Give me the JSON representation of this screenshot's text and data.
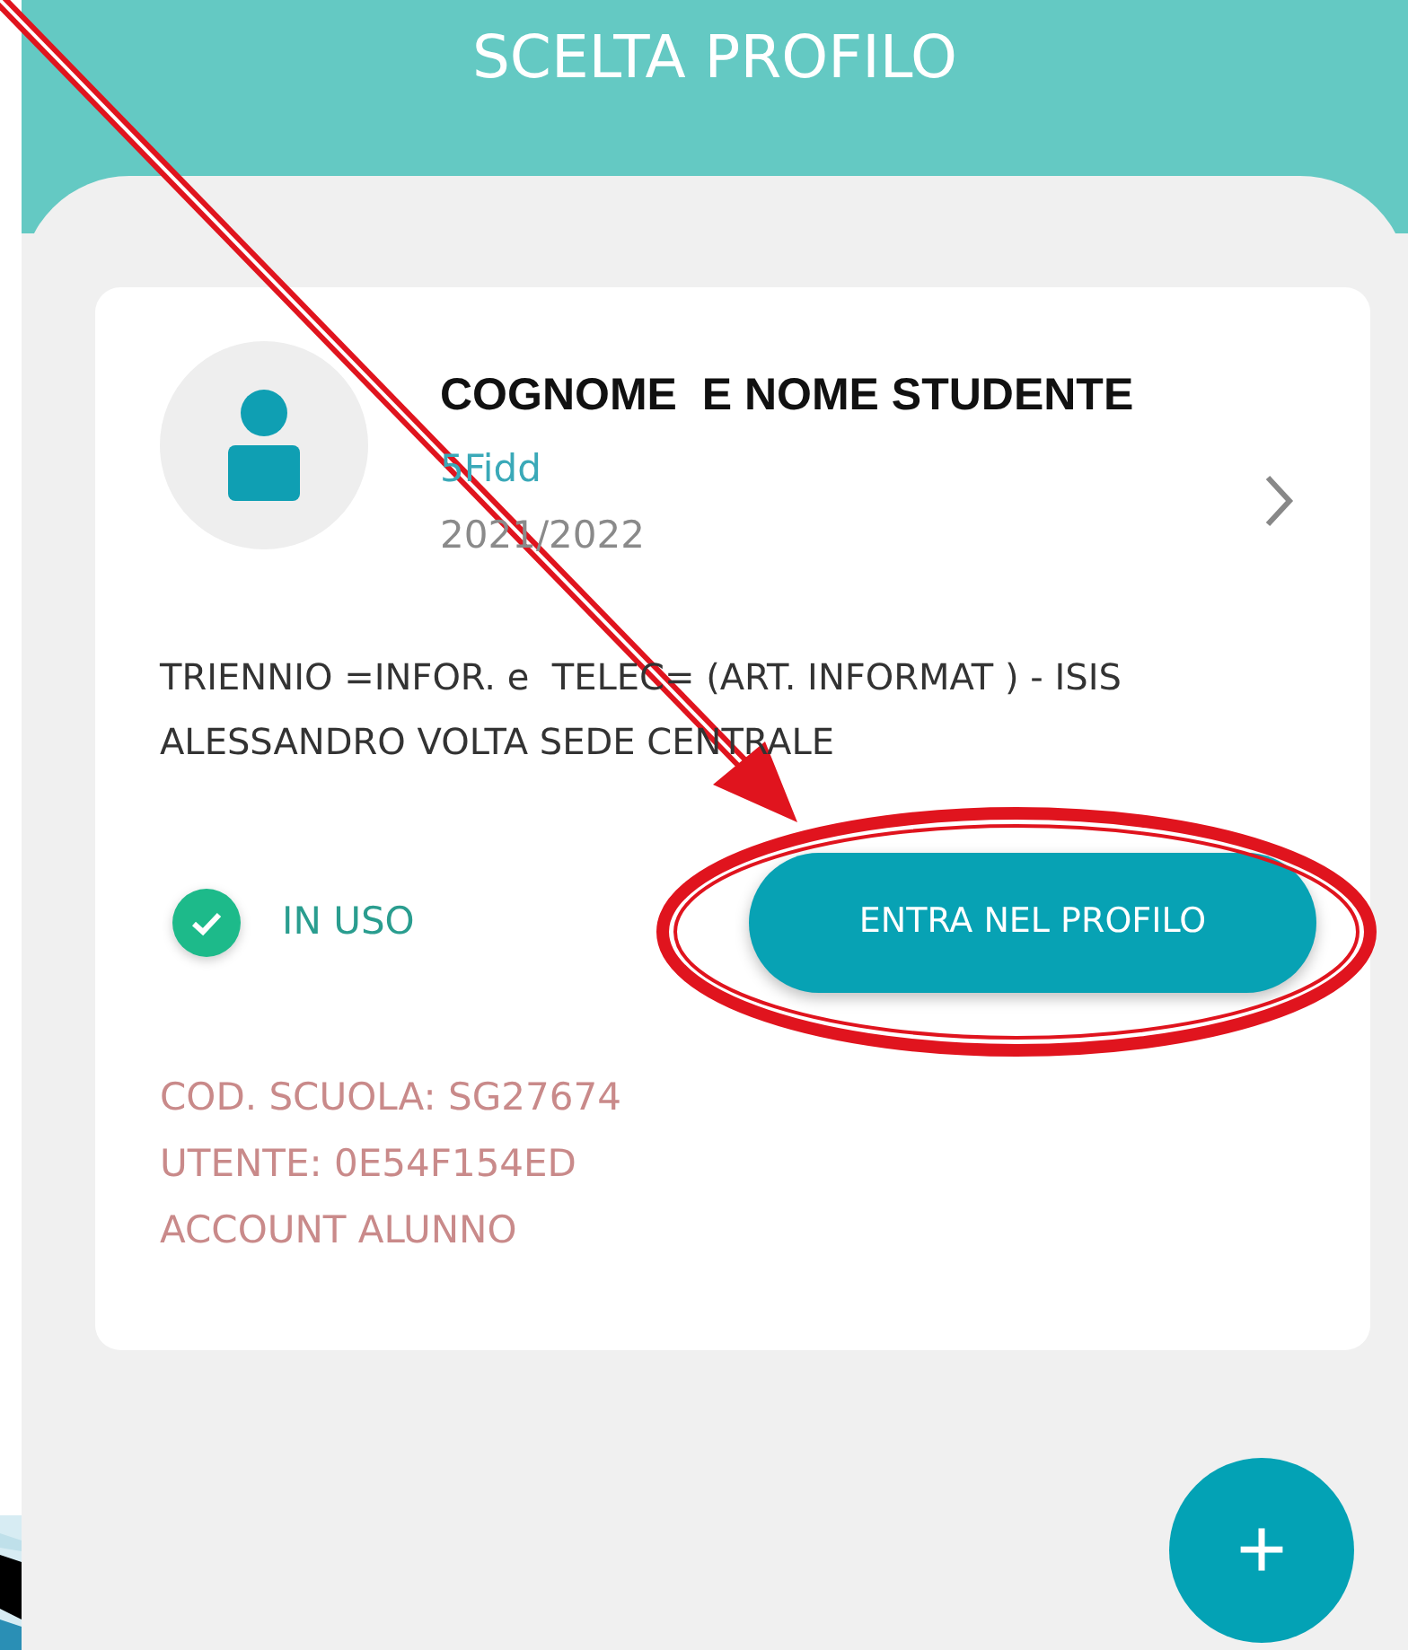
{
  "header": {
    "title": "SCELTA PROFILO"
  },
  "profiles": [
    {
      "name": "COGNOME  E NOME STUDENTE",
      "class": "5Fidd",
      "year": "2021/2022",
      "school": "TRIENNIO =INFOR. e  TELEC= (ART. INFORMAT ) - ISIS ALESSANDRO VOLTA SEDE CENTRALE",
      "in_use": true,
      "status": "IN USO",
      "button": "ENTRA NEL PROFILO",
      "details": [
        "COD. SCUOLA: SG27674",
        "UTENTE: 0E54F154ED",
        "ACCOUNT ALUNNO"
      ]
    }
  ],
  "fab": {
    "label": "+"
  },
  "annotation": {
    "arrow": true,
    "ellipse": true
  }
}
